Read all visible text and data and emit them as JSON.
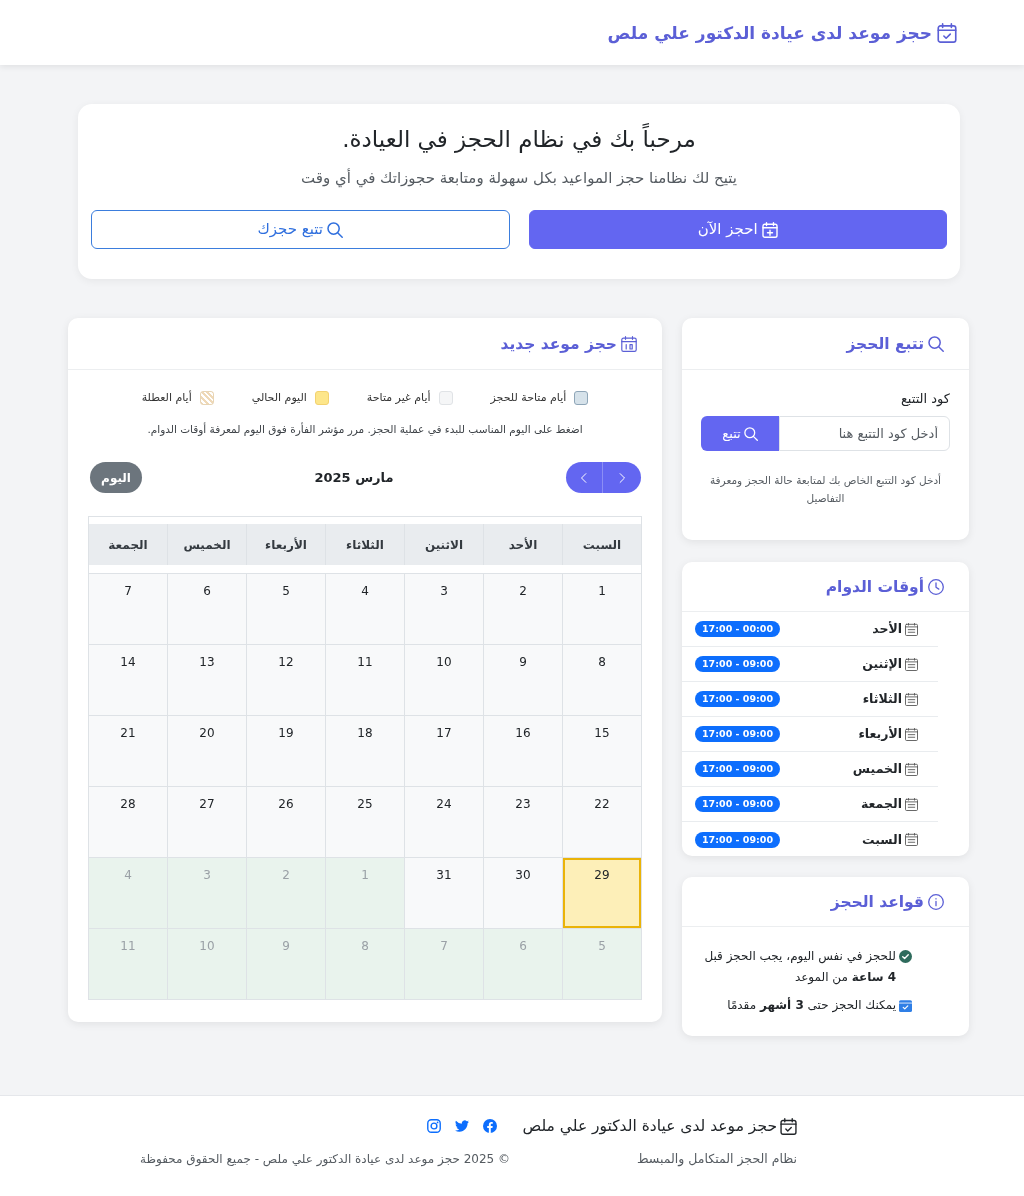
{
  "header": {
    "title": "حجز موعد لدى عيادة الدكتور علي ملص"
  },
  "welcome": {
    "title": "مرحباً بك في نظام الحجز في العيادة.",
    "subtitle": "يتيح لك نظامنا حجز المواعيد بكل سهولة ومتابعة حجوزاتك في أي وقت",
    "buttons": [
      {
        "label": "احجز الآن",
        "kind": "primary"
      },
      {
        "label": "تتبع حجزك",
        "kind": "outline"
      }
    ]
  },
  "booking": {
    "title": "حجز موعد جديد",
    "legend": [
      {
        "label": "أيام متاحة للحجز",
        "kind": "available"
      },
      {
        "label": "أيام غير متاحة",
        "kind": "unavailable"
      },
      {
        "label": "اليوم الحالي",
        "kind": "today"
      },
      {
        "label": "أيام العطلة",
        "kind": "holiday"
      }
    ],
    "hint": "اضغط على اليوم المناسب للبدء في عملية الحجز. مرر مؤشر الفأرة فوق اليوم لمعرفة أوقات الدوام.",
    "calendar": {
      "title": "مارس 2025",
      "today_button": "اليوم",
      "weekdays": [
        "السبت",
        "الأحد",
        "الاثنين",
        "الثلاثاء",
        "الأربعاء",
        "الخميس",
        "الجمعة"
      ],
      "weeks": [
        [
          {
            "day": "1",
            "kind": "month"
          },
          {
            "day": "2",
            "kind": "month"
          },
          {
            "day": "3",
            "kind": "month"
          },
          {
            "day": "4",
            "kind": "month"
          },
          {
            "day": "5",
            "kind": "month"
          },
          {
            "day": "6",
            "kind": "month"
          },
          {
            "day": "7",
            "kind": "month"
          }
        ],
        [
          {
            "day": "8",
            "kind": "month"
          },
          {
            "day": "9",
            "kind": "month"
          },
          {
            "day": "10",
            "kind": "month"
          },
          {
            "day": "11",
            "kind": "month"
          },
          {
            "day": "12",
            "kind": "month"
          },
          {
            "day": "13",
            "kind": "month"
          },
          {
            "day": "14",
            "kind": "month"
          }
        ],
        [
          {
            "day": "15",
            "kind": "month"
          },
          {
            "day": "16",
            "kind": "month"
          },
          {
            "day": "17",
            "kind": "month"
          },
          {
            "day": "18",
            "kind": "month"
          },
          {
            "day": "19",
            "kind": "month"
          },
          {
            "day": "20",
            "kind": "month"
          },
          {
            "day": "21",
            "kind": "month"
          }
        ],
        [
          {
            "day": "22",
            "kind": "month"
          },
          {
            "day": "23",
            "kind": "month"
          },
          {
            "day": "24",
            "kind": "month"
          },
          {
            "day": "25",
            "kind": "month"
          },
          {
            "day": "26",
            "kind": "month"
          },
          {
            "day": "27",
            "kind": "month"
          },
          {
            "day": "28",
            "kind": "month"
          }
        ],
        [
          {
            "day": "29",
            "kind": "today"
          },
          {
            "day": "30",
            "kind": "month"
          },
          {
            "day": "31",
            "kind": "month"
          },
          {
            "day": "1",
            "kind": "other_month"
          },
          {
            "day": "2",
            "kind": "other_month"
          },
          {
            "day": "3",
            "kind": "other_month"
          },
          {
            "day": "4",
            "kind": "other_month"
          }
        ],
        [
          {
            "day": "5",
            "kind": "other_month"
          },
          {
            "day": "6",
            "kind": "other_month"
          },
          {
            "day": "7",
            "kind": "other_month"
          },
          {
            "day": "8",
            "kind": "other_month"
          },
          {
            "day": "9",
            "kind": "other_month"
          },
          {
            "day": "10",
            "kind": "other_month"
          },
          {
            "day": "11",
            "kind": "other_month"
          }
        ]
      ]
    }
  },
  "tracking": {
    "title": "تتبع الحجز",
    "field_label": "كود التتبع",
    "placeholder": "أدخل كود التتبع هنا",
    "button": "تتبع",
    "help": "أدخل كود التتبع الخاص بك لمتابعة حالة الحجز ومعرفة التفاصيل"
  },
  "hours": {
    "title": "أوقات الدوام",
    "rows": [
      {
        "day": "الأحد",
        "time": "17:00 - 00:00"
      },
      {
        "day": "الإثنين",
        "time": "17:00 - 09:00"
      },
      {
        "day": "الثلاثاء",
        "time": "17:00 - 09:00"
      },
      {
        "day": "الأربعاء",
        "time": "17:00 - 09:00"
      },
      {
        "day": "الخميس",
        "time": "17:00 - 09:00"
      },
      {
        "day": "الجمعة",
        "time": "17:00 - 09:00"
      },
      {
        "day": "السبت",
        "time": "17:00 - 09:00"
      }
    ]
  },
  "rules": {
    "title": "قواعد الحجز",
    "items": [
      "للحجز في نفس اليوم، يجب الحجز قبل **4 ساعة** من الموعد",
      "يمكنك الحجز حتى **3 أشهر** مقدمًا"
    ]
  },
  "footer": {
    "brand": "حجز موعد لدى عيادة الدكتور علي ملص",
    "tagline": "نظام الحجز المتكامل والمبسط",
    "copyright": "© 2025 حجز موعد لدى عيادة الدكتور علي ملص - جميع الحقوق محفوظة"
  }
}
